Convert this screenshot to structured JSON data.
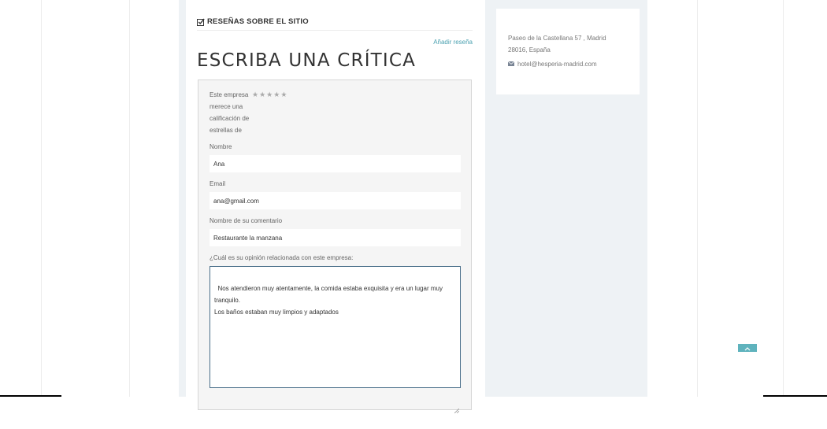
{
  "section": {
    "title": "RESEÑAS SOBRE EL SITIO",
    "icon": "check-square-icon"
  },
  "add_review_link": "Añadir reseña",
  "heading": "ESCRIBA UNA CRÍTICA",
  "rating": {
    "label": "Este empresa merece una calificación de estrellas de",
    "stars": [
      "★",
      "★",
      "★",
      "★",
      "★"
    ],
    "selected": 0
  },
  "fields": {
    "name": {
      "label": "Nombre",
      "value": "Ana"
    },
    "email": {
      "label": "Email",
      "value": "ana@gmail.com"
    },
    "comment_title": {
      "label": "Nombre de su comentario",
      "value": "Restaurante la manzana"
    },
    "opinion": {
      "label": "¿Cuál es su opinión relacionada con este empresa:",
      "value": "Nos atendieron muy atentamente, la comida estaba exquisita y era un lugar muy tranquilo.\nLos baños estaban muy limpios y adaptados"
    }
  },
  "sidebar": {
    "address": "Paseo de la Castellana 57 , Madrid 28016, España",
    "email": "hotel@hesperia-madrid.com",
    "email_icon": "envelope-icon"
  },
  "scroll_top_icon": "chevron-up-icon",
  "colors": {
    "accent": "#4aa0b0",
    "textarea_border": "#4a6f8a",
    "scroll_button": "#5fb3bd"
  }
}
